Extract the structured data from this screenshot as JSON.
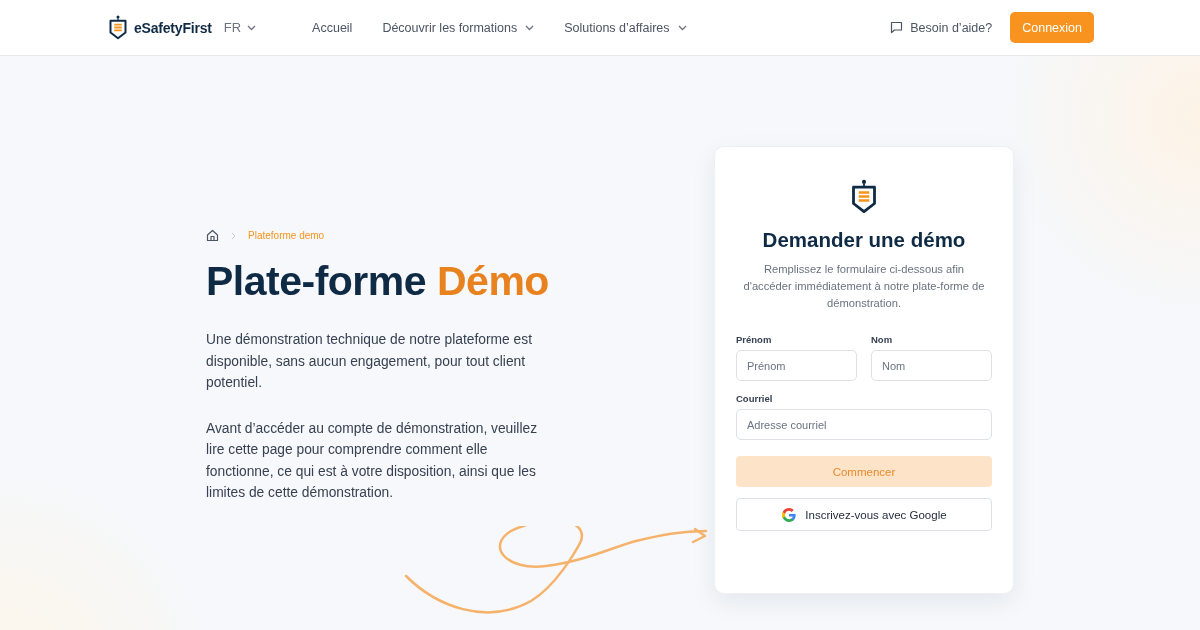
{
  "header": {
    "brand": "eSafetyFirst",
    "language": "FR",
    "nav": [
      {
        "label": "Accueil",
        "has_menu": false
      },
      {
        "label": "Découvrir les formations",
        "has_menu": true
      },
      {
        "label": "Solutions d’affaires",
        "has_menu": true
      }
    ],
    "help": "Besoin d’aide?",
    "login": "Connexion"
  },
  "breadcrumb": {
    "current": "Plateforme demo"
  },
  "title": "Plate-forme",
  "title_accent": "Démo",
  "paragraphs": [
    "Une démonstration technique de notre plateforme est disponible, sans aucun engagement, pour tout client potentiel.",
    "Avant d’accéder au compte de démonstration, veuillez lire cette page pour comprendre comment elle fonctionne, ce qui est à votre disposition, ainsi que les limites de cette démonstration."
  ],
  "form": {
    "title": "Demander une démo",
    "subtitle": "Remplissez le formulaire ci-dessous afin d'accéder immédiatement à notre plate-forme de démonstration.",
    "fields": [
      {
        "label": "Prénom",
        "placeholder": "Prénom"
      },
      {
        "label": "Nom",
        "placeholder": "Nom"
      },
      {
        "label": "Courriel",
        "placeholder": "Adresse courriel"
      }
    ],
    "submit": {
      "label": "Commencer",
      "disabled": true
    },
    "google": "Inscrivez-vous avec Google"
  }
}
